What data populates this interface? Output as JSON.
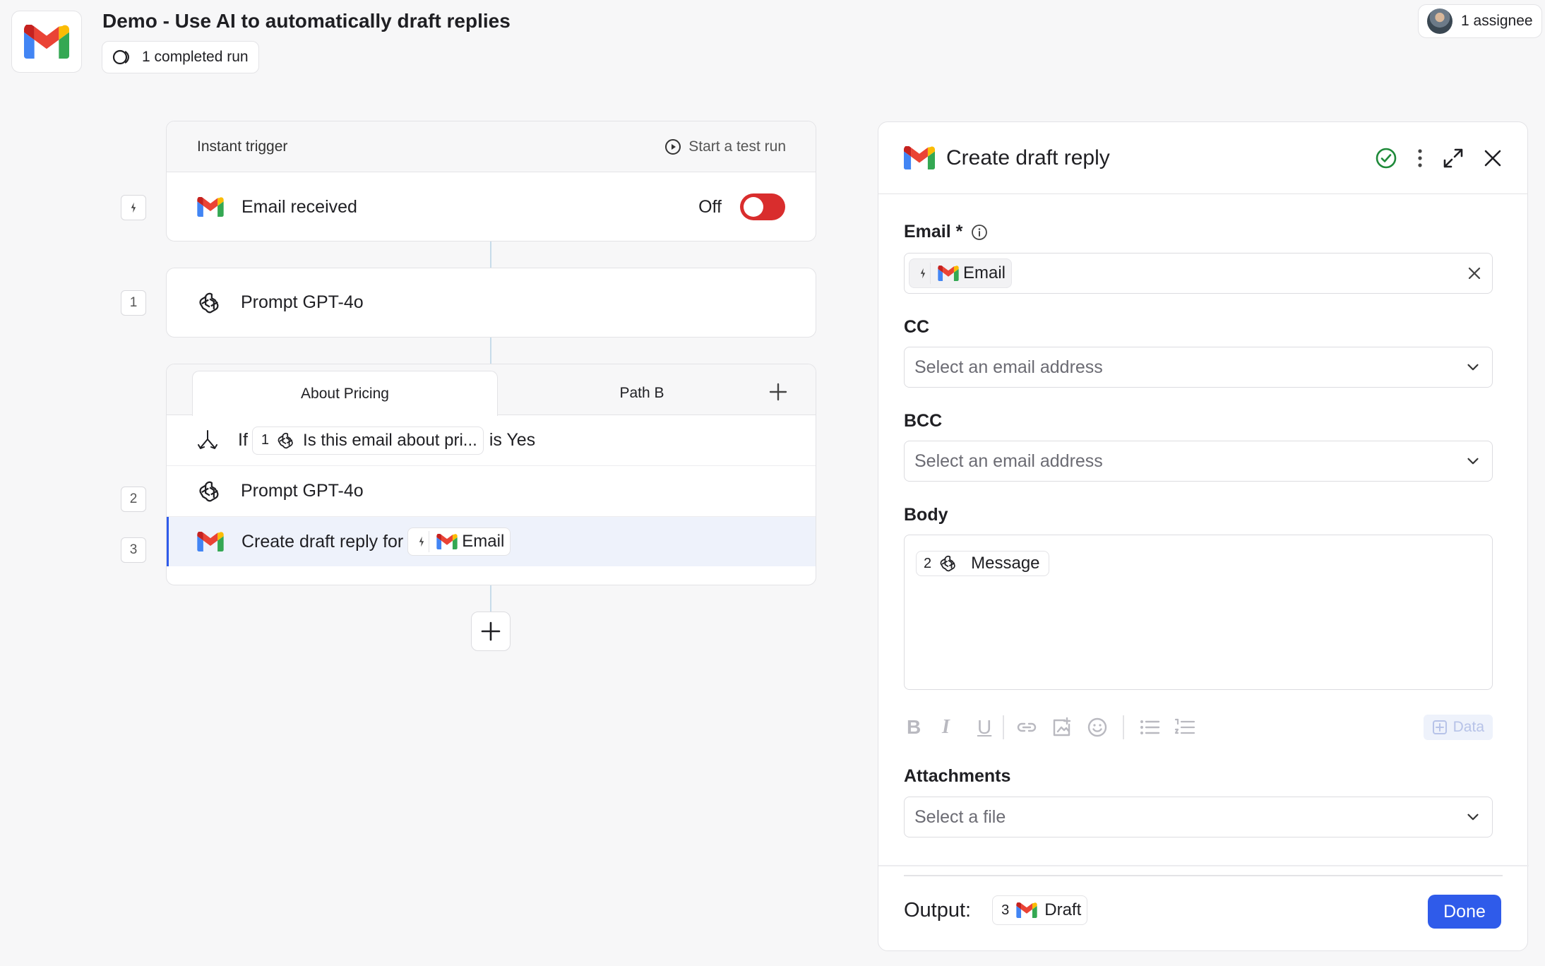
{
  "header": {
    "title": "Demo - Use AI to automatically draft replies",
    "runs_label": "1 completed run",
    "assignee_label": "1 assignee"
  },
  "trigger": {
    "header_label": "Instant trigger",
    "test_run_label": "Start a test run",
    "event_label": "Email received",
    "toggle_label": "Off",
    "toggle_state": "off"
  },
  "steps": {
    "step1": {
      "num": "1",
      "label": "Prompt GPT-4o"
    },
    "paths": {
      "tab_a": "About Pricing",
      "tab_b": "Path B",
      "condition_if": "If",
      "condition_step": "1",
      "condition_text": "Is this email about pri...",
      "condition_suffix": "is Yes"
    },
    "step2": {
      "num": "2",
      "label": "Prompt GPT-4o"
    },
    "step3": {
      "num": "3",
      "label": "Create draft reply for",
      "chip_label": "Email"
    }
  },
  "panel": {
    "title": "Create draft reply",
    "email_label": "Email *",
    "email_chip": "Email",
    "cc_label": "CC",
    "cc_placeholder": "Select an email address",
    "bcc_label": "BCC",
    "bcc_placeholder": "Select an email address",
    "body_label": "Body",
    "body_chip_num": "2",
    "body_chip_label": "Message",
    "data_button": "Data",
    "attachments_label": "Attachments",
    "attachments_placeholder": "Select a file",
    "output_label": "Output:",
    "output_chip_num": "3",
    "output_chip_label": "Draft",
    "done_label": "Done"
  },
  "colors": {
    "accent": "#2f5bea",
    "toggle_off": "#d92d2d",
    "success": "#1f8a3a",
    "selected_row": "#eef2fb"
  }
}
